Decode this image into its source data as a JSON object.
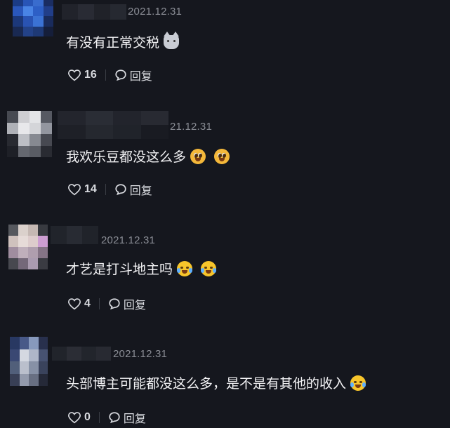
{
  "comments": [
    {
      "date": "2021.12.31",
      "text": "有没有正常交税",
      "emoji": [
        "cat"
      ],
      "likes": "16",
      "reply_label": "回复"
    },
    {
      "date": "21.12.31",
      "text": "我欢乐豆都没这么多",
      "emoji": [
        "pleading",
        "pleading"
      ],
      "likes": "14",
      "reply_label": "回复"
    },
    {
      "date": "2021.12.31",
      "text": "才艺是打斗地主吗",
      "emoji": [
        "joy",
        "joy"
      ],
      "likes": "4",
      "reply_label": "回复"
    },
    {
      "date": "2021.12.31",
      "text": "头部博主可能都没这么多，是不是有其他的收入",
      "emoji": [
        "joy"
      ],
      "likes": "0",
      "reply_label": "回复"
    }
  ],
  "colors": {
    "background": "#15171e",
    "date": "#8a8d95",
    "text": "#f3f3f5",
    "action": "#d9dbe0"
  }
}
